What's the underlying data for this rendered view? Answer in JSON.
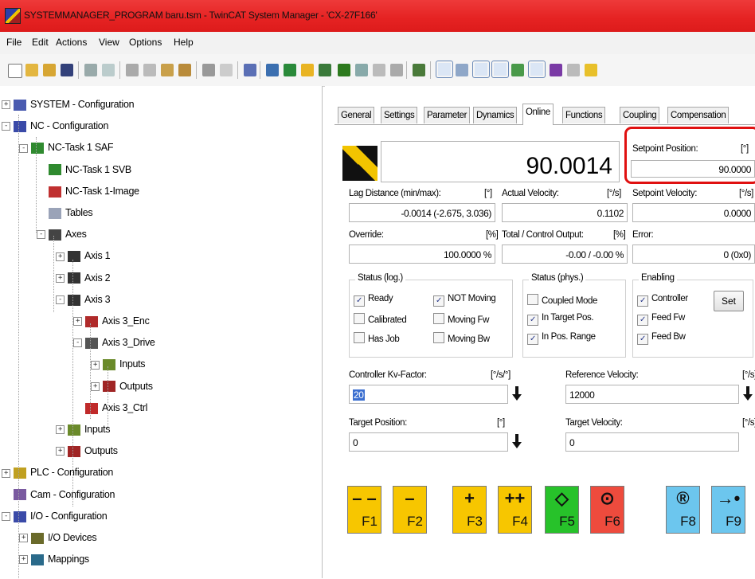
{
  "window": {
    "title": "SYSTEMMANAGER_PROGRAM baru.tsm - TwinCAT System Manager - 'CX-27F166'"
  },
  "menu": [
    "File",
    "Edit",
    "Actions",
    "View",
    "Options",
    "Help"
  ],
  "tree": {
    "items": [
      {
        "label": "SYSTEM - Configuration",
        "icon": "system-config-icon",
        "expander": "+"
      },
      {
        "label": "NC - Configuration",
        "icon": "nc-config-icon",
        "expander": "-"
      },
      {
        "label": "NC-Task 1 SAF",
        "icon": "task-icon",
        "expander": "-"
      },
      {
        "label": "NC-Task 1 SVB",
        "icon": "task-icon",
        "expander": ""
      },
      {
        "label": "NC-Task 1-Image",
        "icon": "image-icon",
        "expander": ""
      },
      {
        "label": "Tables",
        "icon": "table-icon",
        "expander": ""
      },
      {
        "label": "Axes",
        "icon": "axes-icon",
        "expander": "-"
      },
      {
        "label": "Axis 1",
        "icon": "axis-icon",
        "expander": "+"
      },
      {
        "label": "Axis 2",
        "icon": "axis-icon",
        "expander": "+"
      },
      {
        "label": "Axis 3",
        "icon": "axis-icon",
        "expander": "-"
      },
      {
        "label": "Axis 3_Enc",
        "icon": "encoder-icon",
        "expander": "+"
      },
      {
        "label": "Axis 3_Drive",
        "icon": "drive-icon",
        "expander": "-"
      },
      {
        "label": "Inputs",
        "icon": "inputs-icon",
        "expander": "+"
      },
      {
        "label": "Outputs",
        "icon": "outputs-icon",
        "expander": "+"
      },
      {
        "label": "Axis 3_Ctrl",
        "icon": "controller-icon",
        "expander": ""
      },
      {
        "label": "Inputs",
        "icon": "inputs-icon",
        "expander": "+"
      },
      {
        "label": "Outputs",
        "icon": "outputs-icon",
        "expander": "+"
      },
      {
        "label": "PLC - Configuration",
        "icon": "plc-config-icon",
        "expander": "+"
      },
      {
        "label": "Cam - Configuration",
        "icon": "cam-config-icon",
        "expander": ""
      },
      {
        "label": "I/O - Configuration",
        "icon": "io-config-icon",
        "expander": "-"
      },
      {
        "label": "I/O Devices",
        "icon": "io-devices-icon",
        "expander": "+"
      },
      {
        "label": "Mappings",
        "icon": "mappings-icon",
        "expander": "+"
      }
    ]
  },
  "tabs": [
    "General",
    "Settings",
    "Parameter",
    "Dynamics",
    "Online",
    "Functions",
    "Coupling",
    "Compensation"
  ],
  "online": {
    "main_value": "90.0014",
    "setpoint_position": {
      "label": "Setpoint Position:",
      "unit": "[°]",
      "value": "90.0000"
    },
    "lag_distance": {
      "label": "Lag Distance (min/max):",
      "unit": "[°]",
      "value": "-0.0014  (-2.675, 3.036)"
    },
    "actual_velocity": {
      "label": "Actual Velocity:",
      "unit": "[°/s]",
      "value": "0.1102"
    },
    "setpoint_velocity": {
      "label": "Setpoint Velocity:",
      "unit": "[°/s]",
      "value": "0.0000"
    },
    "override": {
      "label": "Override:",
      "unit": "[%]",
      "value": "100.0000 %"
    },
    "total_output": {
      "label": "Total / Control Output:",
      "unit": "[%]",
      "value": "-0.00 / -0.00 %"
    },
    "error": {
      "label": "Error:",
      "value": "0 (0x0)"
    },
    "status_log": {
      "title": "Status (log.)",
      "items": [
        {
          "label": "Ready",
          "checked": true
        },
        {
          "label": "Calibrated",
          "checked": false
        },
        {
          "label": "Has Job",
          "checked": false
        },
        {
          "label": "NOT Moving",
          "checked": true
        },
        {
          "label": "Moving Fw",
          "checked": false
        },
        {
          "label": "Moving Bw",
          "checked": false
        }
      ]
    },
    "status_phys": {
      "title": "Status (phys.)",
      "items": [
        {
          "label": "Coupled Mode",
          "checked": false
        },
        {
          "label": "In Target Pos.",
          "checked": true
        },
        {
          "label": "In Pos. Range",
          "checked": true
        }
      ]
    },
    "enabling": {
      "title": "Enabling",
      "items": [
        {
          "label": "Controller",
          "checked": true
        },
        {
          "label": "Feed Fw",
          "checked": true
        },
        {
          "label": "Feed Bw",
          "checked": true
        }
      ],
      "set_label": "Set"
    },
    "kv_factor": {
      "label": "Controller Kv-Factor:",
      "unit": "[°/s/°]",
      "value": "20"
    },
    "reference_velocity": {
      "label": "Reference Velocity:",
      "unit": "[°/s]",
      "value": "12000"
    },
    "target_position": {
      "label": "Target Position:",
      "unit": "[°]",
      "value": "0"
    },
    "target_velocity": {
      "label": "Target Velocity:",
      "unit": "[°/s]",
      "value": "0"
    }
  },
  "function_keys": [
    {
      "sym": "– –",
      "label": "F1",
      "color": "#f7c600"
    },
    {
      "sym": "–",
      "label": "F2",
      "color": "#f7c600"
    },
    {
      "sym": "+",
      "label": "F3",
      "color": "#f7c600"
    },
    {
      "sym": "++",
      "label": "F4",
      "color": "#f7c600"
    },
    {
      "sym": "◇",
      "label": "F5",
      "color": "#27c22a"
    },
    {
      "sym": "⊙",
      "label": "F6",
      "color": "#ee4b3d"
    },
    {
      "sym": "®",
      "label": "F8",
      "color": "#6cc6ee"
    },
    {
      "sym": "→•",
      "label": "F9",
      "color": "#6cc6ee"
    }
  ],
  "highlight_color": "#e01010"
}
